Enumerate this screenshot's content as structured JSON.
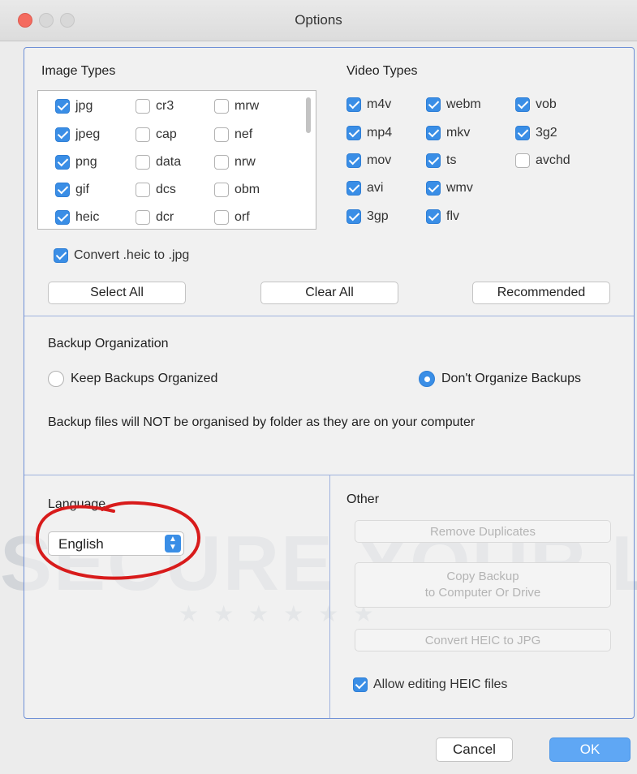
{
  "window": {
    "title": "Options",
    "controls": [
      "close",
      "minimize",
      "maximize"
    ]
  },
  "watermark": {
    "text": "SECURE YOUR LIFE"
  },
  "image_types": {
    "label": "Image Types",
    "items": [
      {
        "name": "jpg",
        "checked": true
      },
      {
        "name": "jpeg",
        "checked": true
      },
      {
        "name": "png",
        "checked": true
      },
      {
        "name": "gif",
        "checked": true
      },
      {
        "name": "heic",
        "checked": true
      },
      {
        "name": "cr3",
        "checked": false
      },
      {
        "name": "cap",
        "checked": false
      },
      {
        "name": "data",
        "checked": false
      },
      {
        "name": "dcs",
        "checked": false
      },
      {
        "name": "dcr",
        "checked": false
      },
      {
        "name": "mrw",
        "checked": false
      },
      {
        "name": "nef",
        "checked": false
      },
      {
        "name": "nrw",
        "checked": false
      },
      {
        "name": "obm",
        "checked": false
      },
      {
        "name": "orf",
        "checked": false
      }
    ],
    "convert_heic": {
      "label": "Convert .heic to .jpg",
      "checked": true
    }
  },
  "video_types": {
    "label": "Video Types",
    "items": [
      {
        "name": "m4v",
        "checked": true
      },
      {
        "name": "mp4",
        "checked": true
      },
      {
        "name": "mov",
        "checked": true
      },
      {
        "name": "avi",
        "checked": true
      },
      {
        "name": "3gp",
        "checked": true
      },
      {
        "name": "webm",
        "checked": true
      },
      {
        "name": "mkv",
        "checked": true
      },
      {
        "name": "ts",
        "checked": true
      },
      {
        "name": "wmv",
        "checked": true
      },
      {
        "name": "flv",
        "checked": true
      },
      {
        "name": "vob",
        "checked": true
      },
      {
        "name": "3g2",
        "checked": true
      },
      {
        "name": "avchd",
        "checked": false
      }
    ]
  },
  "type_buttons": {
    "select_all": "Select All",
    "clear_all": "Clear All",
    "recommended": "Recommended"
  },
  "backup_organization": {
    "label": "Backup Organization",
    "options": [
      {
        "label": "Keep Backups Organized",
        "selected": false
      },
      {
        "label": "Don't Organize Backups",
        "selected": true
      }
    ],
    "note": "Backup files will NOT be organised by folder as they are on your computer"
  },
  "language": {
    "label": "Language",
    "selected": "English"
  },
  "other": {
    "label": "Other",
    "remove_duplicates": "Remove Duplicates",
    "copy_backup_line1": "Copy Backup",
    "copy_backup_line2": "to Computer Or Drive",
    "convert_heic": "Convert HEIC to JPG",
    "allow_editing": {
      "label": "Allow editing HEIC files",
      "checked": true
    }
  },
  "footer": {
    "cancel": "Cancel",
    "ok": "OK"
  },
  "colors": {
    "accent": "#3a8ee6",
    "annotation": "#d81b1b",
    "panel_border": "#6e8fd6"
  },
  "icons": {
    "select_arrows": "chevron-up-down-icon",
    "check": "checkmark-icon"
  }
}
